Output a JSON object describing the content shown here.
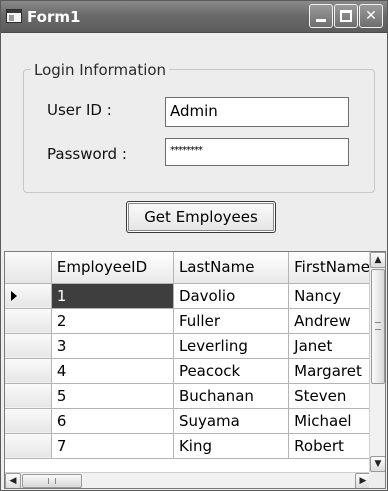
{
  "window": {
    "title": "Form1",
    "icons": {
      "app": "form-window-icon",
      "minimize": "minimize-icon",
      "maximize": "maximize-icon",
      "close": "close-icon"
    },
    "close_glyph": "✕"
  },
  "login_group": {
    "legend": "Login Information",
    "user_id": {
      "label": "User ID :",
      "value": "Admin"
    },
    "password": {
      "label": "Password :",
      "value": "********"
    }
  },
  "actions": {
    "get_employees_label": "Get Employees"
  },
  "grid": {
    "columns": [
      "EmployeeID",
      "LastName",
      "FirstName"
    ],
    "rows": [
      {
        "id": "1",
        "last": "Davolio",
        "first": "Nancy",
        "selected": true
      },
      {
        "id": "2",
        "last": "Fuller",
        "first": "Andrew"
      },
      {
        "id": "3",
        "last": "Leverling",
        "first": "Janet"
      },
      {
        "id": "4",
        "last": "Peacock",
        "first": "Margaret"
      },
      {
        "id": "5",
        "last": "Buchanan",
        "first": "Steven"
      },
      {
        "id": "6",
        "last": "Suyama",
        "first": "Michael"
      },
      {
        "id": "7",
        "last": "King",
        "first": "Robert"
      }
    ],
    "scroll_glyphs": {
      "up": "▲",
      "down": "▼",
      "left": "◀",
      "right": "▶"
    }
  },
  "colors": {
    "selected_cell": "#3e3e3e",
    "titlebar": "#6a6a6a"
  }
}
